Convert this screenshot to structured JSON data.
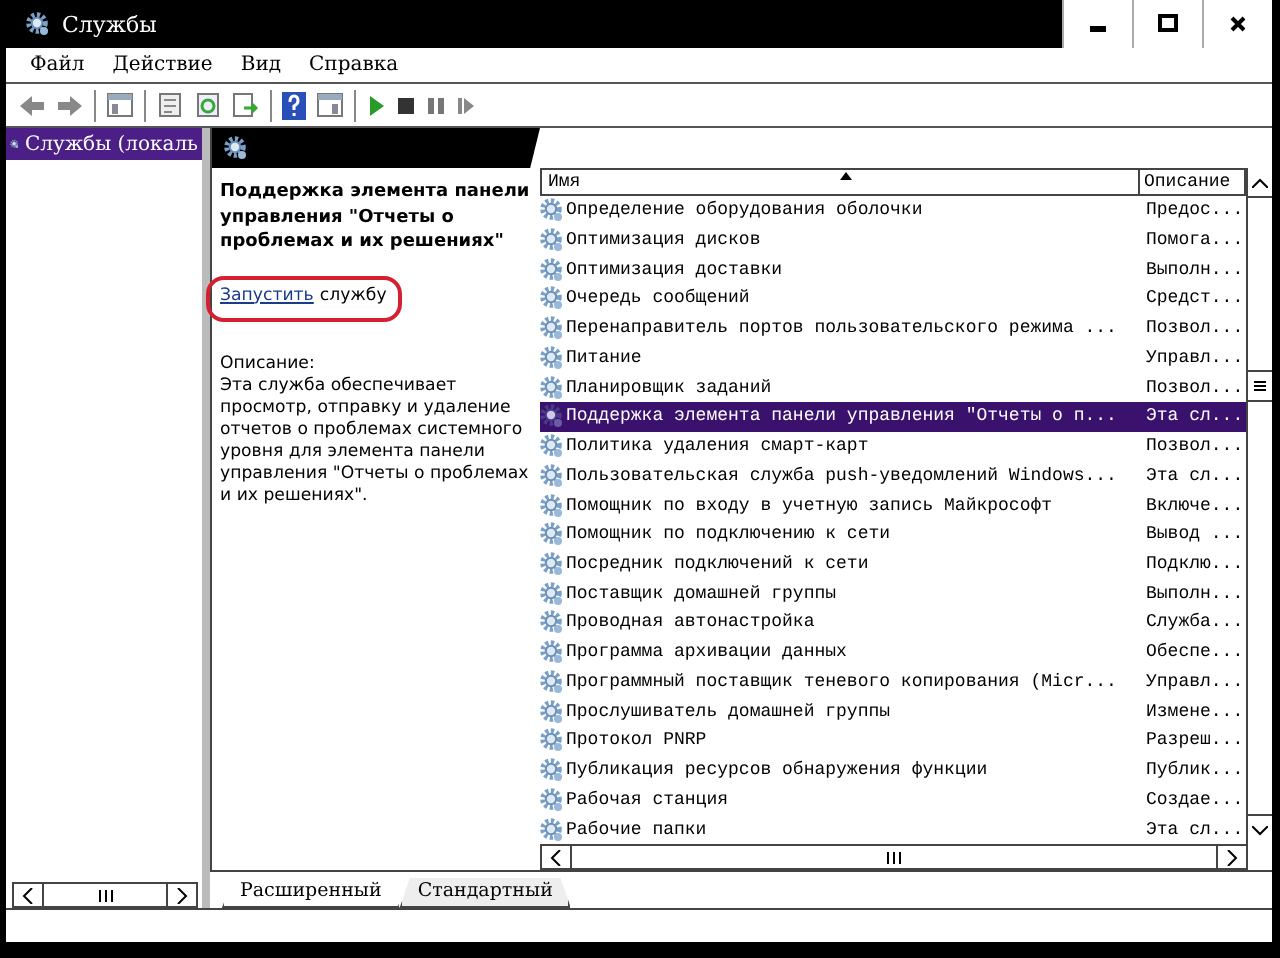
{
  "window": {
    "title": "Службы"
  },
  "menu": [
    "Файл",
    "Действие",
    "Вид",
    "Справка"
  ],
  "tree": {
    "items": [
      {
        "label": "Службы (локаль",
        "selected": true
      }
    ]
  },
  "details": {
    "title": "Поддержка элемента панели управления \"Отчеты о проблемах и их решениях\"",
    "action_link": "Запустить",
    "action_text": "службу",
    "description_label": "Описание:",
    "description": "Эта служба обеспечивает просмотр, отправку и удаление отчетов о проблемах системного уровня для элемента панели управления \"Отчеты о проблемах и их решениях\"."
  },
  "table": {
    "columns": [
      "Имя",
      "Описание"
    ],
    "rows": [
      {
        "name": "Определение оборудования оболочки",
        "description": "Предос...",
        "selected": false
      },
      {
        "name": "Оптимизация дисков",
        "description": "Помога...",
        "selected": false
      },
      {
        "name": "Оптимизация доставки",
        "description": "Выполн...",
        "selected": false
      },
      {
        "name": "Очередь сообщений",
        "description": "Средст...",
        "selected": false
      },
      {
        "name": "Перенаправитель портов пользовательского режима ...",
        "description": "Позвол...",
        "selected": false
      },
      {
        "name": "Питание",
        "description": "Управл...",
        "selected": false
      },
      {
        "name": "Планировщик заданий",
        "description": "Позвол...",
        "selected": false
      },
      {
        "name": "Поддержка элемента панели управления \"Отчеты о п...",
        "description": "Эта сл...",
        "selected": true
      },
      {
        "name": "Политика удаления смарт-карт",
        "description": "Позвол...",
        "selected": false
      },
      {
        "name": "Пользовательская служба push-уведомлений Windows...",
        "description": "Эта сл...",
        "selected": false
      },
      {
        "name": "Помощник по входу в учетную запись Майкрософт",
        "description": "Включе...",
        "selected": false
      },
      {
        "name": "Помощник по подключению к сети",
        "description": "Вывод ...",
        "selected": false
      },
      {
        "name": "Посредник подключений к сети",
        "description": "Подклю...",
        "selected": false
      },
      {
        "name": "Поставщик домашней группы",
        "description": "Выполн...",
        "selected": false
      },
      {
        "name": "Проводная автонастройка",
        "description": "Служба...",
        "selected": false
      },
      {
        "name": "Программа архивации данных",
        "description": "Обеспе...",
        "selected": false
      },
      {
        "name": "Программный поставщик теневого копирования (Micr...",
        "description": "Управл...",
        "selected": false
      },
      {
        "name": "Прослушиватель домашней группы",
        "description": "Измене...",
        "selected": false
      },
      {
        "name": "Протокол PNRP",
        "description": "Разреш...",
        "selected": false
      },
      {
        "name": "Публикация ресурсов обнаружения функции",
        "description": "Публик...",
        "selected": false
      },
      {
        "name": "Рабочая станция",
        "description": "Создае...",
        "selected": false
      },
      {
        "name": "Рабочие папки",
        "description": "Эта сл...",
        "selected": false
      }
    ]
  },
  "tabs": [
    {
      "label": "Расширенный",
      "selected": true
    },
    {
      "label": "Стандартный",
      "selected": false
    }
  ]
}
